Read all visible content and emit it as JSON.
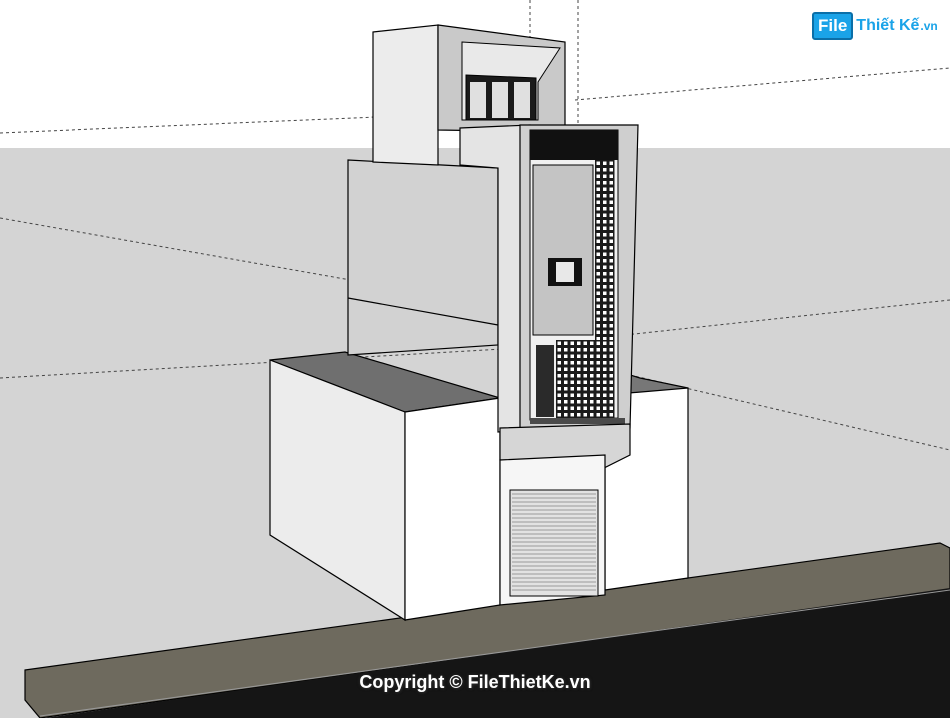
{
  "watermark": {
    "logo_box": "File",
    "logo_text": "Thiết Kế",
    "logo_suffix": ".vn"
  },
  "footer": {
    "copyright": "Copyright © FileThietKe.vn"
  },
  "colors": {
    "sky": "#ffffff",
    "ground": "#d4d4d4",
    "sidewalk": "#6e6a5e",
    "road": "#151515",
    "wall_light": "#f4f4f4",
    "wall_mid": "#d9d9d9",
    "wall_dark": "#8a8a8a",
    "edge": "#000000",
    "watermark_blue": "#1aa3e8"
  },
  "icons": {
    "copyright_symbol": "copyright-icon"
  }
}
